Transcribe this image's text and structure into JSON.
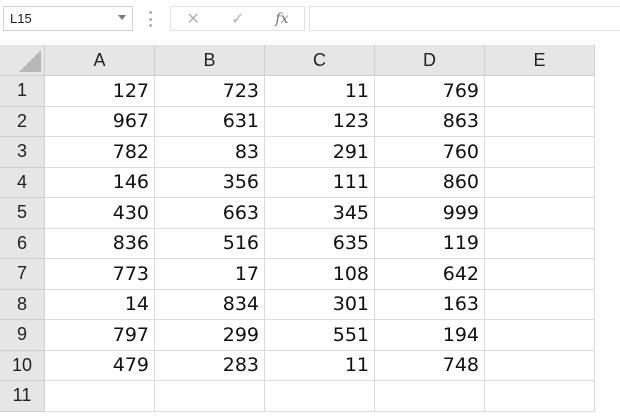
{
  "formula_bar": {
    "name_box": "L15",
    "cancel_icon": "✕",
    "enter_icon": "✓",
    "fx_label": "fx",
    "formula_value": ""
  },
  "sheet": {
    "columns": [
      "A",
      "B",
      "C",
      "D",
      "E"
    ],
    "rows": [
      {
        "num": "1",
        "cells": [
          "127",
          "723",
          "11",
          "769",
          ""
        ]
      },
      {
        "num": "2",
        "cells": [
          "967",
          "631",
          "123",
          "863",
          ""
        ]
      },
      {
        "num": "3",
        "cells": [
          "782",
          "83",
          "291",
          "760",
          ""
        ]
      },
      {
        "num": "4",
        "cells": [
          "146",
          "356",
          "111",
          "860",
          ""
        ]
      },
      {
        "num": "5",
        "cells": [
          "430",
          "663",
          "345",
          "999",
          ""
        ]
      },
      {
        "num": "6",
        "cells": [
          "836",
          "516",
          "635",
          "119",
          ""
        ]
      },
      {
        "num": "7",
        "cells": [
          "773",
          "17",
          "108",
          "642",
          ""
        ]
      },
      {
        "num": "8",
        "cells": [
          "14",
          "834",
          "301",
          "163",
          ""
        ]
      },
      {
        "num": "9",
        "cells": [
          "797",
          "299",
          "551",
          "194",
          ""
        ]
      },
      {
        "num": "10",
        "cells": [
          "479",
          "283",
          "11",
          "748",
          ""
        ]
      },
      {
        "num": "11",
        "cells": [
          "",
          "",
          "",
          "",
          ""
        ]
      }
    ]
  },
  "colors": {
    "header_bg": "#e6e6e6",
    "gridline": "#dadada",
    "text": "#111111"
  }
}
